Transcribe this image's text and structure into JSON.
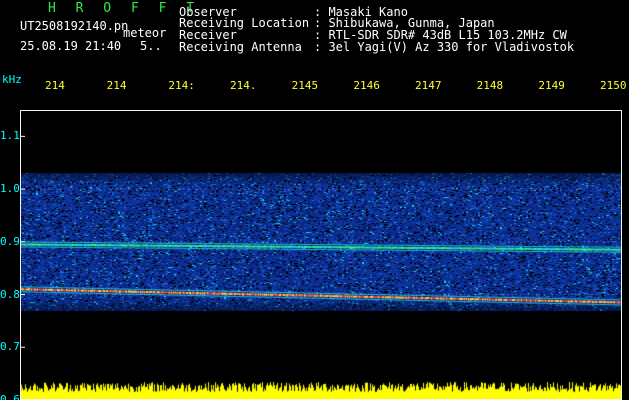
{
  "header": {
    "logo": "H R O F F T",
    "file_name": "UT2508192140.pn",
    "meteor_label": "meteor",
    "datetime": "25.08.19 21:40",
    "count": "5..",
    "fields": [
      {
        "label": "Observer",
        "value": ": Masaki Kano"
      },
      {
        "label": "Receiving Location",
        "value": ": Shibukawa, Gunma, Japan"
      },
      {
        "label": "Receiver",
        "value": ": RTL-SDR SDR# 43dB L15 103.2MHz CW"
      },
      {
        "label": "Receiving Antenna",
        "value": ": 3el Yagi(V) Az 330 for Vladivostok"
      }
    ]
  },
  "axes": {
    "y_unit": "kHz",
    "y_ticks": [
      "1.1",
      "1.0",
      "0.9",
      "0.8",
      "0.7",
      "0.6"
    ],
    "x_ticks": [
      "214",
      "214",
      "214:",
      "214.",
      "2145",
      "2146",
      "2147",
      "2148",
      "2149",
      "2150"
    ]
  },
  "colors": {
    "background": "#000000",
    "header_text": "#ffffff",
    "logo": "#2ee84a",
    "time_ticks": "#ffff33",
    "freq_ticks": "#00ffff",
    "grid": "#f4f4f4",
    "noise_bar": "#ffff00",
    "spectrogram_low": "#0a2a8a",
    "spectrogram_mid": "#18c0d8",
    "spectrogram_high": "#ff3030"
  },
  "chart_data": {
    "type": "heatmap",
    "xlabel": "",
    "ylabel": "kHz",
    "ylim": [
      0.6,
      1.15
    ],
    "x_ticks": [
      "214",
      "214",
      "214:",
      "214.",
      "2145",
      "2146",
      "2147",
      "2148",
      "2149",
      "2150"
    ],
    "y_ticks": [
      1.1,
      1.0,
      0.9,
      0.8,
      0.7,
      0.6
    ],
    "band_khz": [
      0.77,
      1.03
    ],
    "carriers_khz": [
      0.895,
      0.81
    ],
    "carrier_drift_khz": [
      -0.01,
      -0.025
    ]
  }
}
